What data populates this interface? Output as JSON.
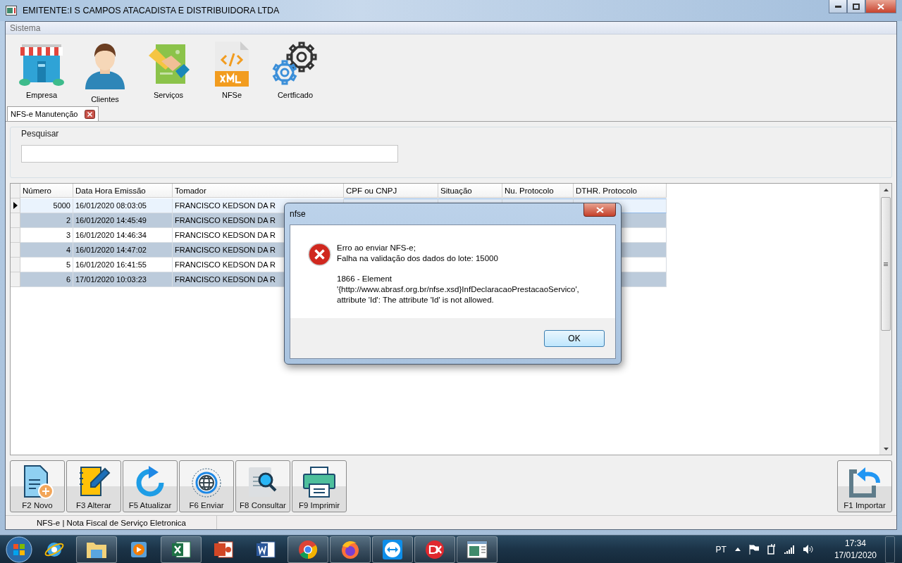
{
  "window": {
    "title": "EMITENTE:I S CAMPOS ATACADISTA E DISTRIBUIDORA LTDA"
  },
  "menu": [
    "Sistema"
  ],
  "toolbar": [
    {
      "label": "Empresa"
    },
    {
      "label": "Clientes"
    },
    {
      "label": "Serviços"
    },
    {
      "label": "NFSe"
    },
    {
      "label": "Certficado"
    }
  ],
  "tabs": [
    {
      "label": "NFS-e Manutenção",
      "selected": true
    }
  ],
  "search": {
    "title": "Pesquisar"
  },
  "table": {
    "columns": [
      "Número",
      "Data Hora Emissão",
      "Tomador",
      "CPF ou CNPJ",
      "Situação",
      "Nu. Protocolo",
      "DTHR. Protocolo"
    ],
    "rows": [
      {
        "numero": "5000",
        "data_hora": "16/01/2020 08:03:05",
        "tomador": "FRANCISCO KEDSON DA R",
        "selected": true
      },
      {
        "numero": "2",
        "data_hora": "16/01/2020 14:45:49",
        "tomador": "FRANCISCO KEDSON DA R",
        "selected": false
      },
      {
        "numero": "3",
        "data_hora": "16/01/2020 14:46:34",
        "tomador": "FRANCISCO KEDSON DA R",
        "selected": false
      },
      {
        "numero": "4",
        "data_hora": "16/01/2020 14:47:02",
        "tomador": "FRANCISCO KEDSON DA R",
        "selected": false
      },
      {
        "numero": "5",
        "data_hora": "16/01/2020 16:41:55",
        "tomador": "FRANCISCO KEDSON DA R",
        "selected": false
      },
      {
        "numero": "6",
        "data_hora": "17/01/2020 10:03:23",
        "tomador": "FRANCISCO KEDSON DA R",
        "selected": false
      }
    ]
  },
  "actions": [
    {
      "label": "F2 Novo",
      "kind": "novo"
    },
    {
      "label": "F3 Alterar",
      "kind": "alterar"
    },
    {
      "label": "F5 Atualizar",
      "kind": "atualizar"
    },
    {
      "label": "F6 Enviar",
      "kind": "enviar"
    },
    {
      "label": "F8 Consultar",
      "kind": "consultar"
    },
    {
      "label": "F9 Imprimir",
      "kind": "imprimir"
    }
  ],
  "import_action": {
    "label": "F1 Importar"
  },
  "status_bar": "NFS-e | Nota Fiscal de Serviço Eletronica",
  "dialog": {
    "title": "nfse",
    "paragraphs": [
      "Erro ao enviar NFS-e;\nFalha na validação dos dados do lote: 15000",
      "1866 - Element\n'{http://www.abrasf.org.br/nfse.xsd}InfDeclaracaoPrestacaoServico',\nattribute 'Id': The attribute 'Id' is not allowed."
    ],
    "button": "OK"
  },
  "taskbar": {
    "apps": [
      {
        "running": false
      },
      {
        "running": true
      },
      {
        "running": false
      },
      {
        "running": true
      },
      {
        "running": false
      },
      {
        "running": false
      },
      {
        "running": true
      },
      {
        "running": true
      },
      {
        "running": true
      },
      {
        "running": true
      },
      {
        "running": true
      }
    ],
    "language": "PT",
    "time": "17:34",
    "date": "17/01/2020"
  }
}
